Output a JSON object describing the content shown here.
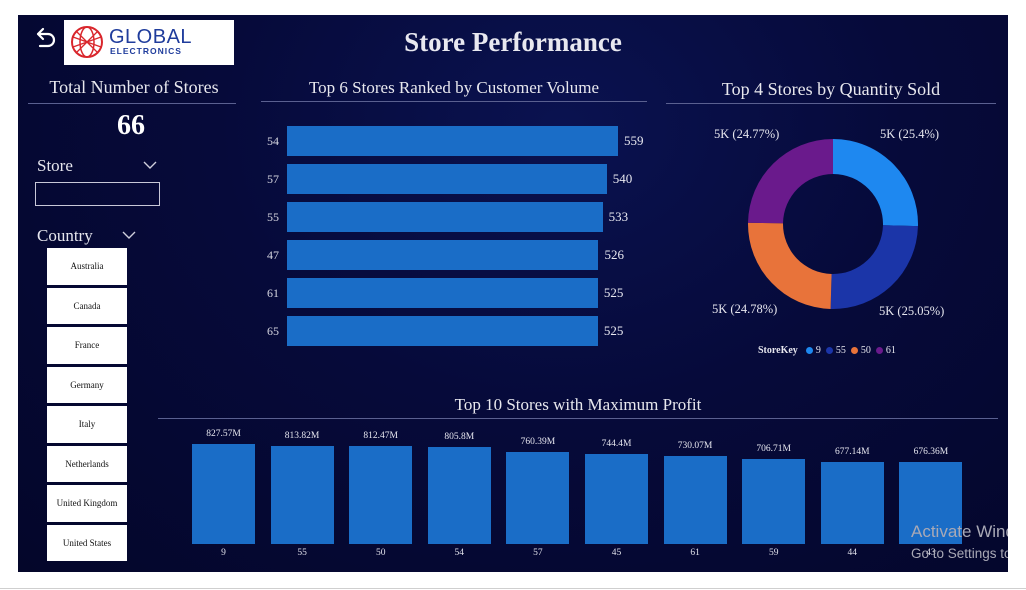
{
  "dashboard": {
    "title": "Store Performance",
    "logo": {
      "line1": "GLOBAL",
      "line2": "ELECTRONICS"
    }
  },
  "kpi": {
    "label": "Total Number of Stores",
    "value": "66"
  },
  "slicers": {
    "store": {
      "label": "Store",
      "value": ""
    },
    "country": {
      "label": "Country",
      "items": [
        "Australia",
        "Canada",
        "France",
        "Germany",
        "Italy",
        "Netherlands",
        "United Kingdom",
        "United States"
      ]
    }
  },
  "colors": {
    "bar": "#1a6dc7",
    "donut": [
      "#1e88f0",
      "#1b35a8",
      "#e8733a",
      "#6a1a8c"
    ]
  },
  "chart_data": [
    {
      "type": "bar",
      "orientation": "horizontal",
      "title": "Top 6 Stores Ranked by Customer Volume",
      "categories": [
        "54",
        "57",
        "55",
        "47",
        "61",
        "65"
      ],
      "values": [
        559,
        540,
        533,
        526,
        525,
        525
      ],
      "xlim": [
        0,
        620
      ]
    },
    {
      "type": "pie",
      "donut": true,
      "title": "Top 4 Stores by Quantity Sold",
      "legend_title": "StoreKey",
      "legend_position": "bottom",
      "categories": [
        "9",
        "55",
        "50",
        "61"
      ],
      "percent": [
        25.4,
        25.05,
        24.78,
        24.77
      ],
      "labels": [
        "5K (25.4%)",
        "5K (25.05%)",
        "5K (24.78%)",
        "5K (24.77%)"
      ]
    },
    {
      "type": "bar",
      "title": "Top 10 Stores with Maximum Profit",
      "categories": [
        "9",
        "55",
        "50",
        "54",
        "57",
        "45",
        "61",
        "59",
        "44",
        "43"
      ],
      "values": [
        827.57,
        813.82,
        812.47,
        805.8,
        760.39,
        744.4,
        730.07,
        706.71,
        677.14,
        676.36
      ],
      "labels": [
        "827.57M",
        "813.82M",
        "812.47M",
        "805.8M",
        "760.39M",
        "744.4M",
        "730.07M",
        "706.71M",
        "677.14M",
        "676.36M"
      ],
      "ylim": [
        0,
        840
      ]
    }
  ],
  "watermark": {
    "line1": "Activate Windows",
    "line2": "Go to Settings to activate Windows."
  }
}
